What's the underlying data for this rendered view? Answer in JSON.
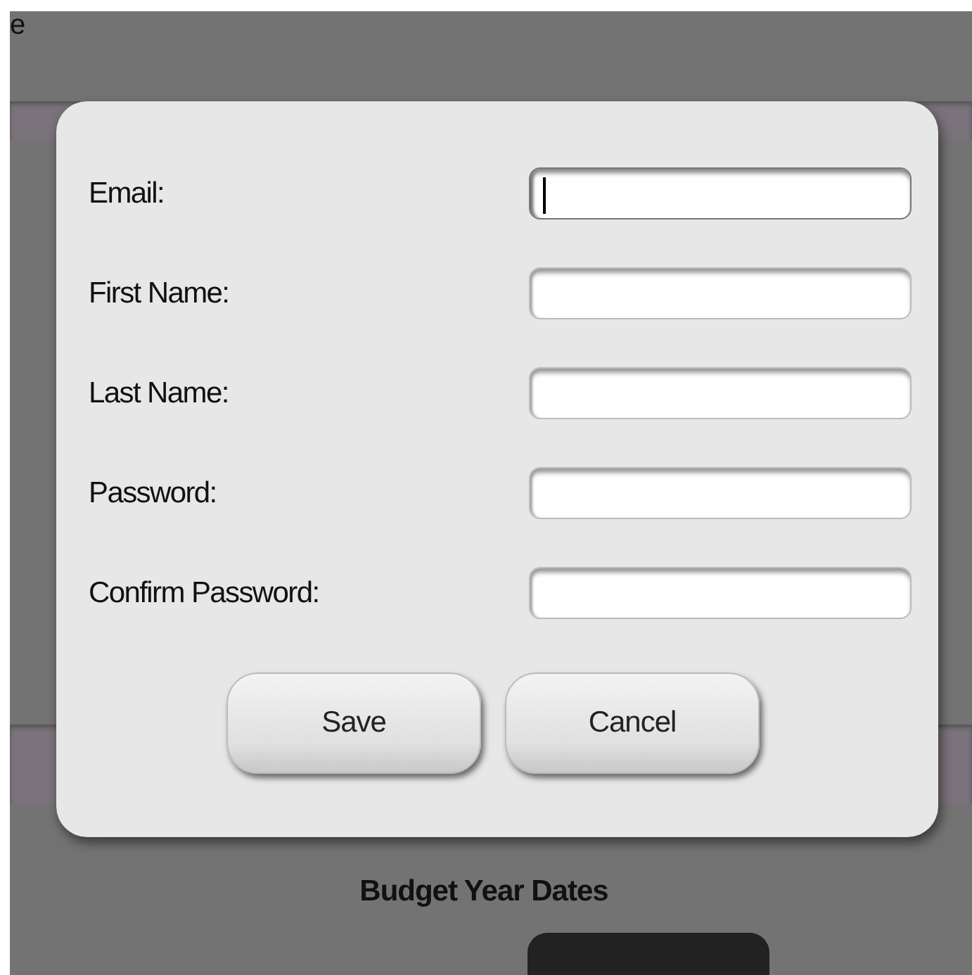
{
  "page": {
    "heading_fragment": "e",
    "section_title": "Budget Year Dates"
  },
  "dialog": {
    "fields": [
      {
        "label": "Email:",
        "focused": true
      },
      {
        "label": "First Name:",
        "focused": false
      },
      {
        "label": "Last Name:",
        "focused": false
      },
      {
        "label": "Password:",
        "focused": false
      },
      {
        "label": "Confirm Password:",
        "focused": false
      }
    ],
    "buttons": [
      "Save",
      "Cancel"
    ]
  }
}
